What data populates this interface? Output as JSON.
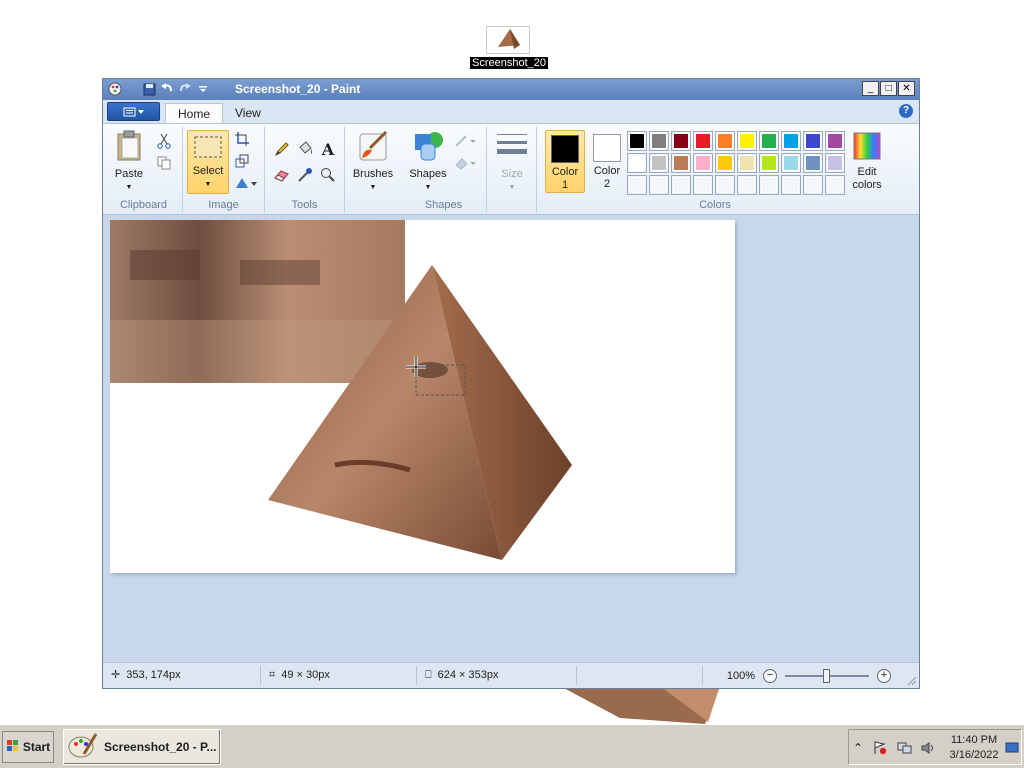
{
  "desktop": {
    "icon_label": "Screenshot_20"
  },
  "window": {
    "title": "Screenshot_20 - Paint",
    "controls": {
      "minimize": "_",
      "maximize": "□",
      "close": "✕"
    }
  },
  "ribbon": {
    "tabs": [
      {
        "label": "Home",
        "active": true
      },
      {
        "label": "View",
        "active": false
      }
    ],
    "help": "?",
    "groups": {
      "clipboard": {
        "name": "Clipboard",
        "paste": "Paste"
      },
      "image": {
        "name": "Image",
        "select": "Select"
      },
      "tools": {
        "name": "Tools"
      },
      "brushes": {
        "label": "Brushes"
      },
      "shapes": {
        "name": "Shapes",
        "label": "Shapes"
      },
      "size": {
        "label": "Size"
      },
      "colors": {
        "name": "Colors",
        "color1_label_a": "Color",
        "color1_label_b": "1",
        "color2_label_a": "Color",
        "color2_label_b": "2",
        "color1": "#000000",
        "color2": "#ffffff",
        "edit_label_a": "Edit",
        "edit_label_b": "colors",
        "palette": [
          "#000000",
          "#7f7f7f",
          "#880015",
          "#ed1c24",
          "#ff7f27",
          "#fff200",
          "#22b14c",
          "#00a2e8",
          "#3f48cc",
          "#a349a4",
          "#ffffff",
          "#c3c3c3",
          "#b97a57",
          "#ffaec9",
          "#ffc90e",
          "#efe4b0",
          "#b5e61d",
          "#99d9ea",
          "#7092be",
          "#c8bfe7",
          "",
          "",
          "",
          "",
          "",
          "",
          "",
          "",
          "",
          ""
        ]
      }
    }
  },
  "status": {
    "cursor_pos": "353, 174px",
    "selection_size": "49 × 30px",
    "image_size": "624 × 353px",
    "zoom": "100%"
  },
  "taskbar": {
    "start_label": "Start",
    "task_label": "Screenshot_20 - P...",
    "time": "11:40 PM",
    "date": "3/16/2022"
  }
}
